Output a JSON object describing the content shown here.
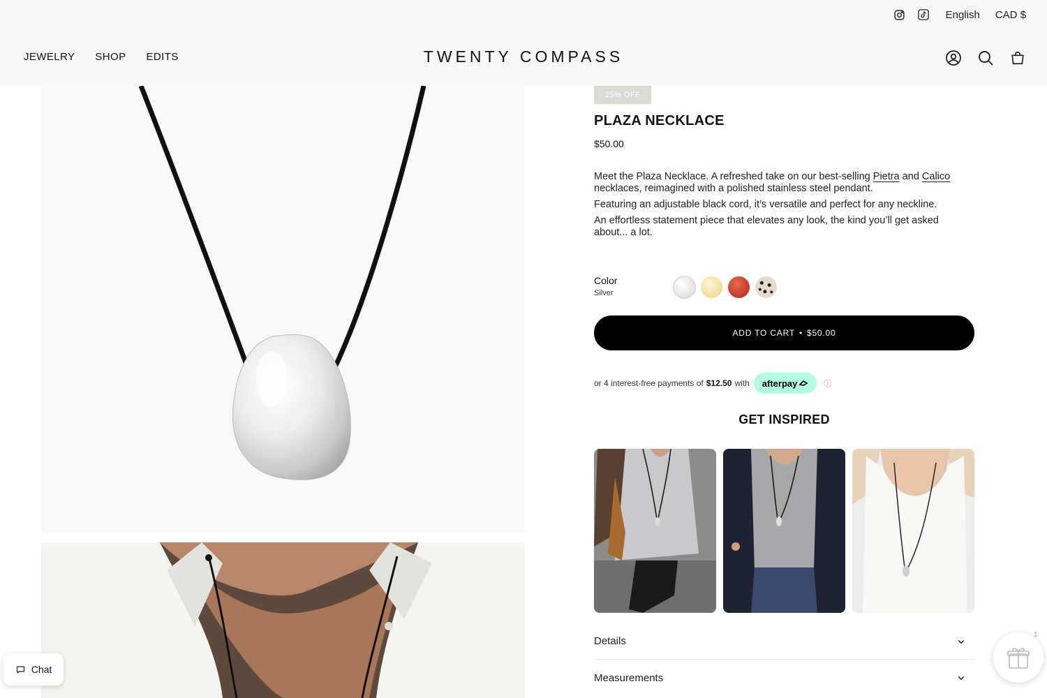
{
  "topbar": {
    "language": "English",
    "currency": "CAD $"
  },
  "nav": {
    "items": [
      "JEWELRY",
      "SHOP",
      "EDITS"
    ]
  },
  "brand": {
    "logo": "TWENTY COMPASS"
  },
  "product": {
    "badge": "25% OFF",
    "title": "PLAZA NECKLACE",
    "price": "$50.00",
    "description": {
      "p1_before": "Meet the Plaza Necklace. A refreshed take on our best-selling ",
      "link1": "Pietra",
      "p1_mid": " and ",
      "link2": "Calico",
      "p1_after": " necklaces, reimagined with a polished stainless steel pendant.",
      "p2": "Featuring an adjustable black cord, it’s versatile and perfect for any neckline.",
      "p3": "An effortless statement piece that elevates any look, the kind you’ll get asked about... a lot."
    },
    "color_label": "Color",
    "color_value": "Silver",
    "swatch_colors": [
      "#eeeeee",
      "#f5e3a8",
      "#c9402c",
      "#d9cfc2"
    ],
    "add_to_cart": "ADD TO CART",
    "add_to_cart_sep": "•",
    "add_to_cart_price": "$50.00"
  },
  "afterpay": {
    "prefix": "or 4 interest-free payments of",
    "amount": "$12.50",
    "suffix": "with",
    "brand": "afterpay",
    "info": "ⓘ"
  },
  "inspired": {
    "title": "GET INSPIRED"
  },
  "accordion": {
    "details": "Details",
    "measurements": "Measurements"
  },
  "chat": {
    "label": "Chat"
  },
  "gift": {
    "count": "1"
  },
  "colors": {
    "button": "#000000",
    "badge": "#d9dbd4",
    "afterpay": "#b2fce4"
  }
}
